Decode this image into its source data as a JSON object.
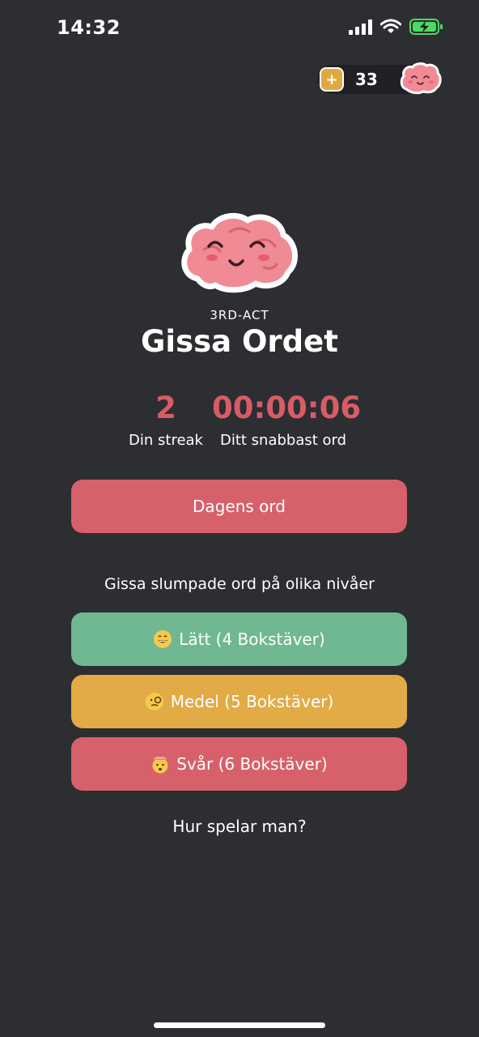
{
  "status_bar": {
    "time": "14:32"
  },
  "coins": {
    "count": "33",
    "plus_label": "+"
  },
  "header": {
    "brand": "3RD-ACT",
    "title": "Gissa Ordet"
  },
  "stats": {
    "streak_value": "2",
    "streak_label": "Din streak",
    "fastest_value": "00:00:06",
    "fastest_label": "Ditt snabbast ord"
  },
  "daily_button": {
    "label": "Dagens ord"
  },
  "levels": {
    "heading": "Gissa slumpade ord på olika nivåer",
    "easy": {
      "label": "Lätt (4 Bokstäver)",
      "icon": "grinning-face-icon"
    },
    "medium": {
      "label": "Medel (5 Bokstäver)",
      "icon": "monocle-face-icon"
    },
    "hard": {
      "label": "Svår (6 Bokstäver)",
      "icon": "exploding-head-icon"
    }
  },
  "help_link": {
    "label": "Hur spelar man?"
  },
  "colors": {
    "background": "#2c2e32",
    "accent_red": "#d6616a",
    "accent_green": "#6fb891",
    "accent_yellow": "#e2ab45"
  }
}
